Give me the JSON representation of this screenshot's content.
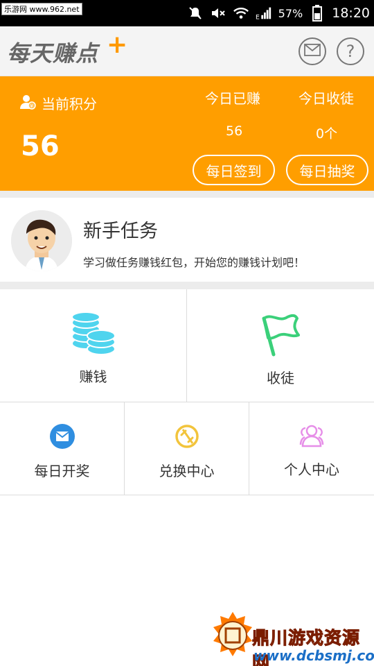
{
  "status_bar": {
    "watermark": "乐游网 www.962.net",
    "network": "E",
    "battery": "57%",
    "time": "18:20"
  },
  "header": {
    "title": "每天赚点",
    "plus": "+",
    "icons": [
      "mail-icon",
      "help-icon"
    ],
    "help_glyph": "?"
  },
  "points": {
    "label": "当前积分",
    "value": "56",
    "today_earned_label": "今日已赚",
    "today_earned_value": "56",
    "today_apprentice_label": "今日收徒",
    "today_apprentice_value": "0个",
    "checkin_button": "每日签到",
    "lottery_button": "每日抽奖"
  },
  "newbie": {
    "title": "新手任务",
    "desc": "学习做任务赚钱红包，开始您的赚钱计划吧！"
  },
  "grid": {
    "earn": {
      "label": "赚钱",
      "icon": "coins-icon",
      "color": "#4fd4ee"
    },
    "apprentice": {
      "label": "收徒",
      "icon": "flag-icon",
      "color": "#3bd07a"
    },
    "daily_lottery": {
      "label": "每日开奖",
      "icon": "mail-circle-icon",
      "color": "#2f8ee0"
    },
    "exchange": {
      "label": "兑换中心",
      "icon": "exchange-icon",
      "color": "#f2c43c"
    },
    "profile": {
      "label": "个人中心",
      "icon": "users-icon",
      "color": "#e68ee8"
    }
  },
  "watermark": {
    "text": "鼎川游戏资源网",
    "url": "www.dcbsmj.com"
  },
  "colors": {
    "accent": "#ff9e00",
    "divider": "#dcdcdc"
  }
}
